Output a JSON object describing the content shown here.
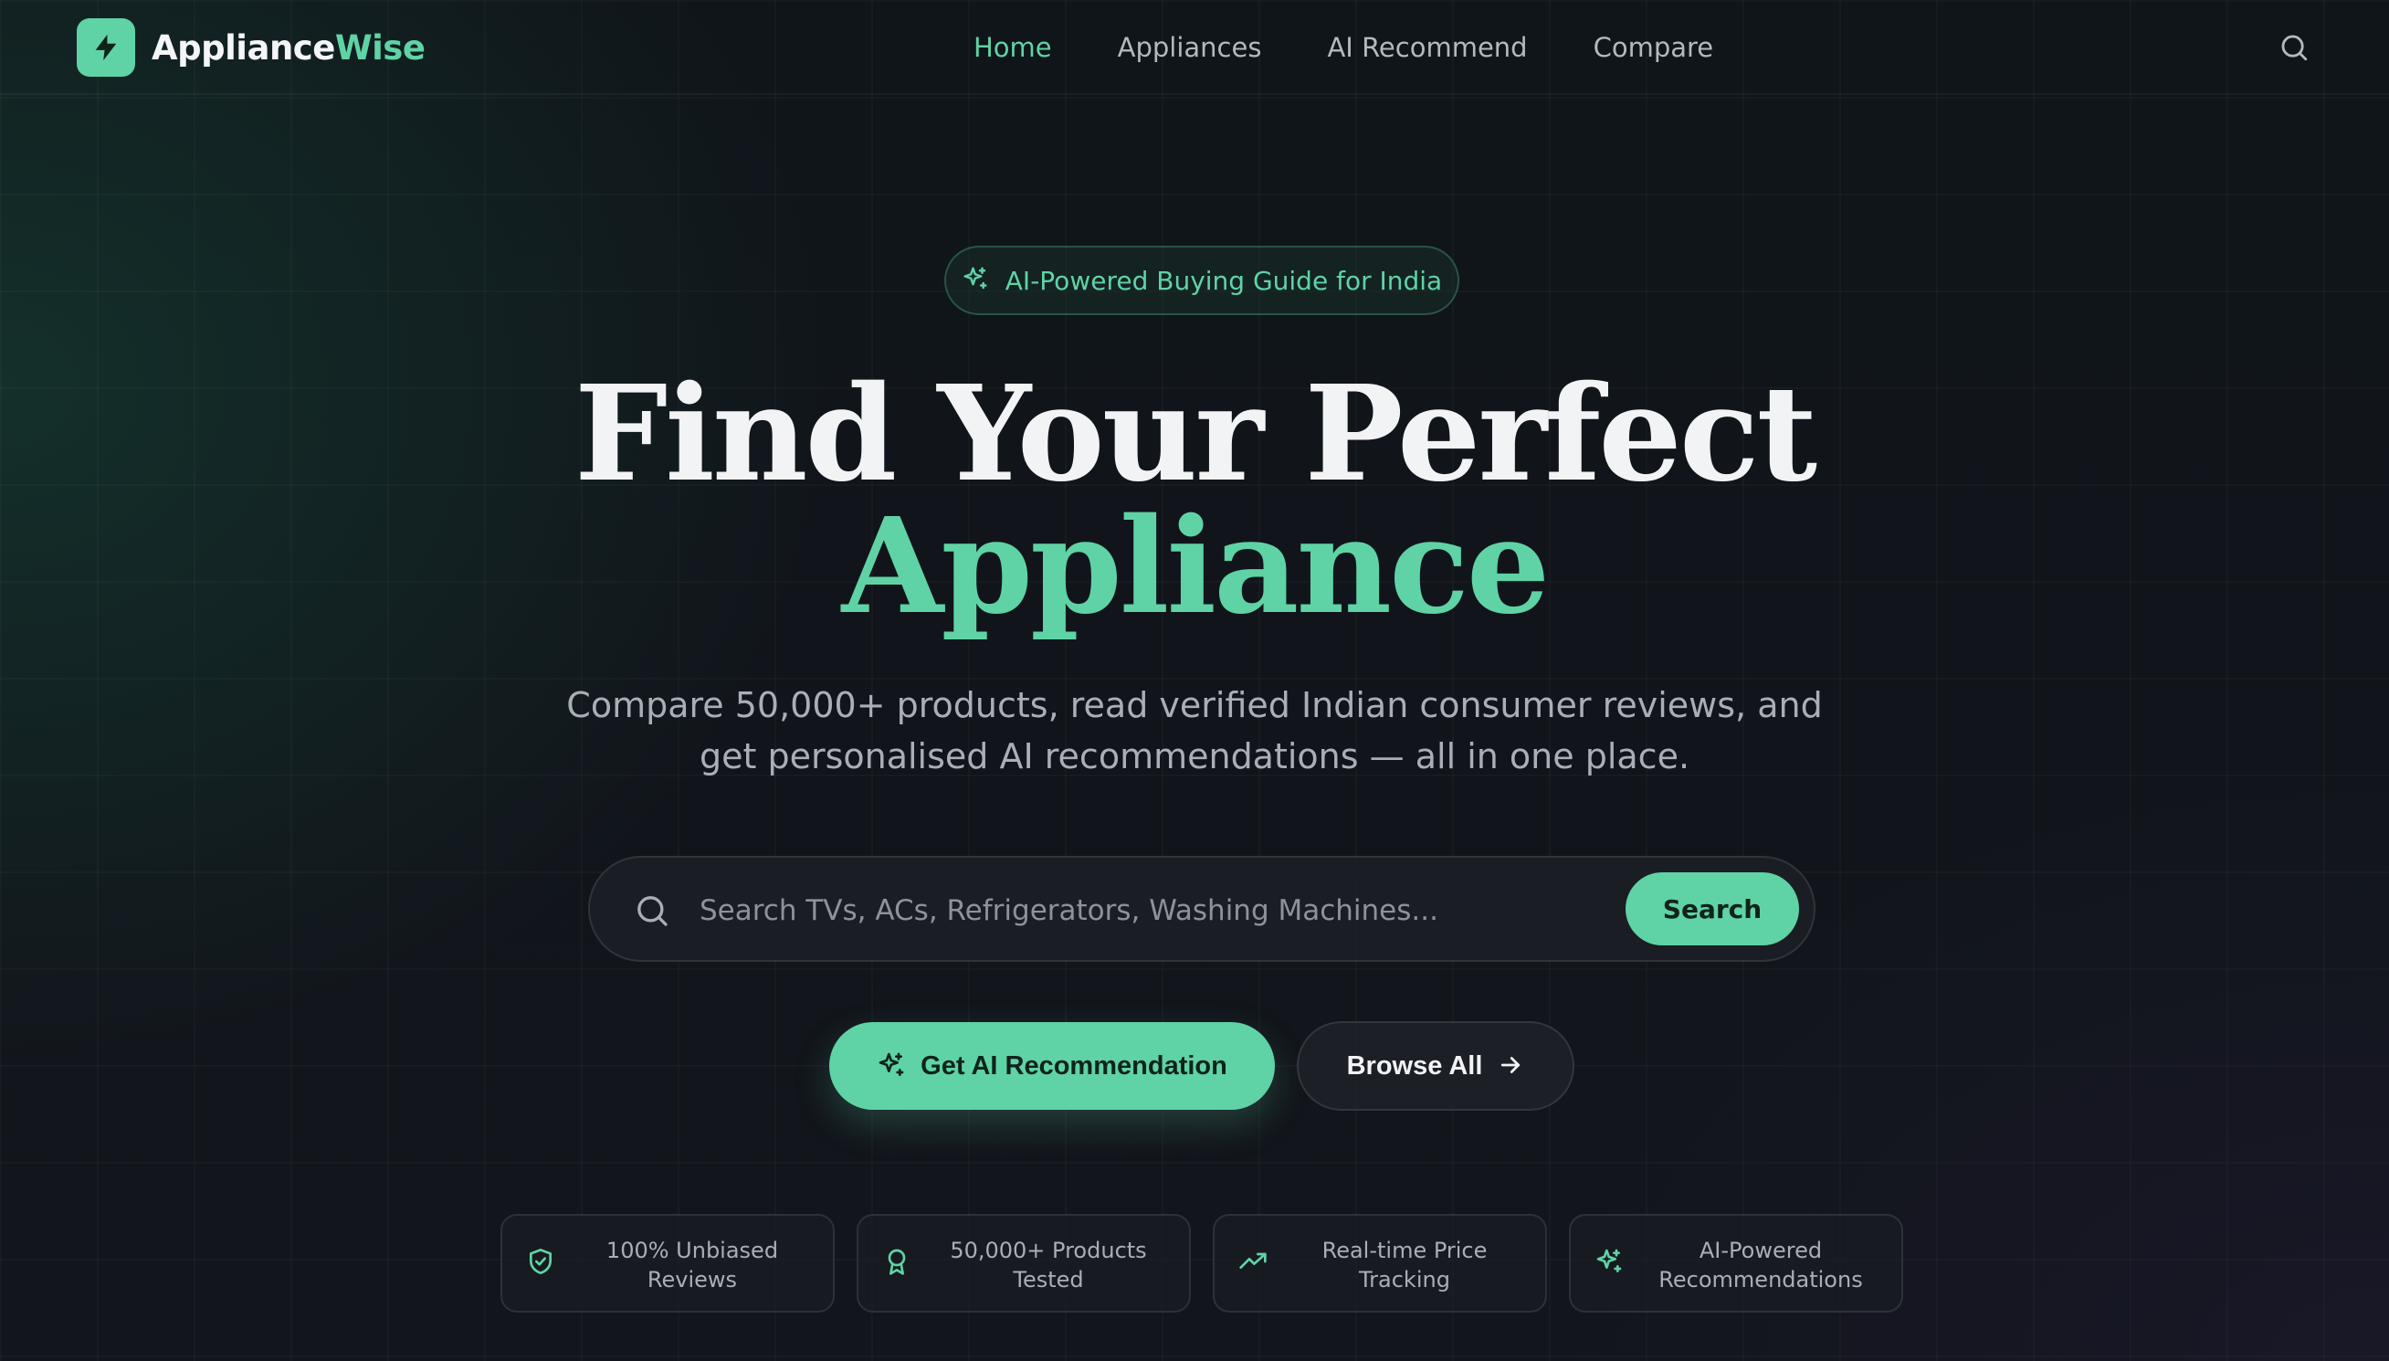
{
  "brand": {
    "name_part1": "Appliance",
    "name_part2": "Wise",
    "logo_icon": "bolt-icon",
    "accent_color": "#5fd3a5"
  },
  "nav": {
    "items": [
      {
        "label": "Home",
        "active": true
      },
      {
        "label": "Appliances",
        "active": false
      },
      {
        "label": "AI Recommend",
        "active": false
      },
      {
        "label": "Compare",
        "active": false
      }
    ],
    "search_icon": "search-icon"
  },
  "hero": {
    "badge_text": "AI-Powered Buying Guide for India",
    "badge_icon": "sparkles-icon",
    "headline_line1": "Find Your Perfect",
    "headline_line2": "Appliance",
    "subtitle": "Compare 50,000+ products, read verified Indian consumer reviews, and get personalised AI recommendations — all in one place."
  },
  "search": {
    "placeholder": "Search TVs, ACs, Refrigerators, Washing Machines...",
    "button_label": "Search"
  },
  "cta": {
    "primary_label": "Get AI Recommendation",
    "primary_icon": "sparkles-icon",
    "secondary_label": "Browse All",
    "secondary_icon": "arrow-right-icon"
  },
  "features": [
    {
      "icon": "shield-check-icon",
      "label": "100% Unbiased Reviews"
    },
    {
      "icon": "award-icon",
      "label": "50,000+ Products Tested"
    },
    {
      "icon": "trending-up-icon",
      "label": "Real-time Price Tracking"
    },
    {
      "icon": "sparkles-icon",
      "label": "AI-Powered Recommendations"
    }
  ]
}
